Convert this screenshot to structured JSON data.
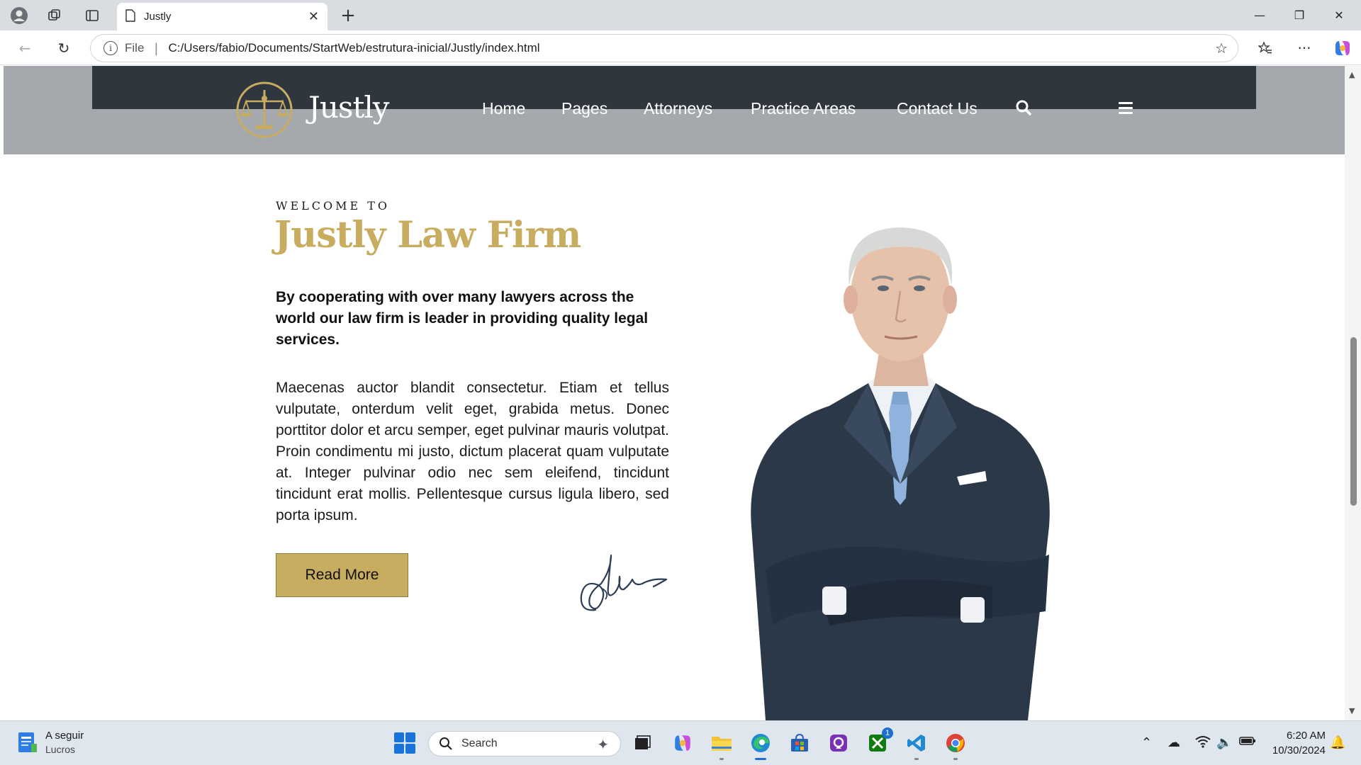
{
  "browser": {
    "tab_title": "Justly",
    "address_prefix": "File",
    "address_url": "C:/Users/fabio/Documents/StartWeb/estrutura-inicial/Justly/index.html"
  },
  "site": {
    "logo_text": "Justly",
    "nav": [
      "Home",
      "Pages",
      "Attorneys",
      "Practice Areas",
      "Contact Us"
    ],
    "welcome_label": "WELCOME TO",
    "title": "Justly Law Firm",
    "lead": "By cooperating with over many lawyers across the world our law firm is leader in providing quality legal services.",
    "body": "Maecenas auctor blandit consectetur. Etiam et tellus vulputate, onterdum velit eget, grabida metus. Donec porttitor dolor et arcu semper, eget pulvinar mauris volutpat. Proin condimentu mi justo, dictum placerat quam vulputate at. Integer pulvinar odio nec sem eleifend, tincidunt tincidunt erat mollis. Pellentesque cursus ligula libero, sed porta ipsum.",
    "cta": "Read More",
    "accent_color": "#c8ac5f"
  },
  "taskbar": {
    "weather_title": "A seguir",
    "weather_subtitle": "Lucros",
    "search_placeholder": "Search",
    "store_badge": "1",
    "time": "6:20 AM",
    "date": "10/30/2024"
  },
  "icons": [
    "profile-icon",
    "workspaces-icon",
    "tab-actions-icon",
    "page-icon",
    "close-icon",
    "plus-icon",
    "back-icon",
    "refresh-icon",
    "info-icon",
    "star-icon",
    "favorites-icon",
    "more-icon",
    "copilot-icon",
    "search-icon",
    "menu-icon",
    "windows-icon",
    "chevron-up-icon",
    "wifi-icon",
    "volume-icon",
    "battery-icon",
    "bell-icon"
  ]
}
